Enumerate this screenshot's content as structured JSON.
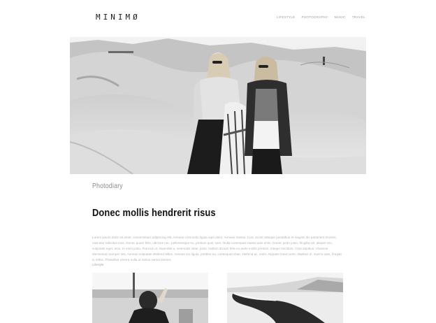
{
  "header": {
    "logo": "MINIMØ",
    "nav": [
      "LIFESTYLE",
      "PHOTOGRAPHY",
      "MUSIC",
      "TRAVEL"
    ]
  },
  "post": {
    "category": "Photodiary",
    "title": "Donec mollis hendrerit risus",
    "body": "Lorem ipsum dolor sit amet, consectetuer adipiscing elit. Aenean commodo ligula eget dolor. Aenean massa. Cum sociis natoque penatibus et magnis dis parturient montes, nascetur ridiculus mus. Donec quam felis, ultricies nec, pellentesque eu, pretium quis, sem. Nulla consequat massa quis enim. Donec pede justo, fringilla vel, aliquet nec, vulputate eget, arcu. In enim justo, rhoncus ut, imperdiet a, venenatis vitae, justo. Nullam dictum felis eu pede mollis pretium. Integer tincidunt. Cras dapibus. Vivamus elementum semper nisi. Aenean vulputate eleifend tellus. Aenean leo ligula, porttitor eu, consequat vitae, eleifend ac, enim. Aliquam lorem ante, dapibus in, viverra quis, feugiat a, tellus. Phasellus viverra nulla ut metus varius laoreet.",
    "tag": "Lifestyle"
  }
}
